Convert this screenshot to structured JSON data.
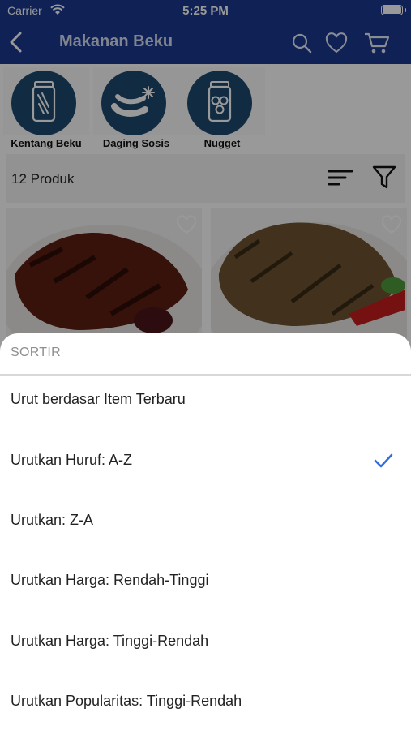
{
  "status_bar": {
    "carrier": "Carrier",
    "time": "5:25 PM"
  },
  "navbar": {
    "title": "Makanan Beku"
  },
  "categories": [
    {
      "label": "Kentang Beku",
      "icon": "fries-jar-icon"
    },
    {
      "label": "Daging Sosis",
      "icon": "sausage-icon"
    },
    {
      "label": "Nugget",
      "icon": "nugget-jar-icon"
    }
  ],
  "results": {
    "count_label": "12 Produk"
  },
  "sort_sheet": {
    "title": "SORTIR",
    "options": [
      {
        "label": "Urut berdasar Item Terbaru",
        "selected": false
      },
      {
        "label": "Urutkan Huruf: A-Z",
        "selected": true
      },
      {
        "label": "Urutkan: Z-A",
        "selected": false
      },
      {
        "label": "Urutkan Harga: Rendah-Tinggi",
        "selected": false
      },
      {
        "label": "Urutkan Harga: Tinggi-Rendah",
        "selected": false
      },
      {
        "label": "Urutkan Popularitas: Tinggi-Rendah",
        "selected": false
      }
    ]
  },
  "colors": {
    "brand": "#1c3a8e",
    "check": "#2f6fe0"
  }
}
